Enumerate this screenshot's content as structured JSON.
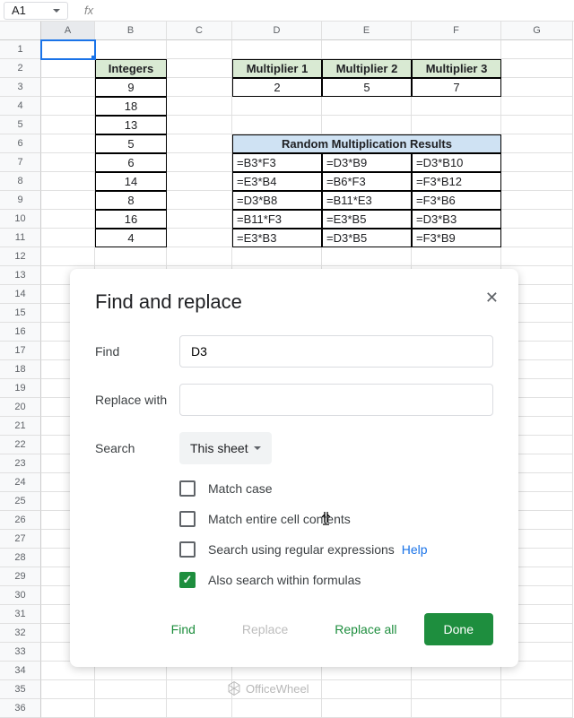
{
  "namebox": "A1",
  "fx_label": "fx",
  "col_headers": [
    "A",
    "B",
    "C",
    "D",
    "E",
    "F",
    "G"
  ],
  "row_count": 36,
  "integers": {
    "title": "Integers",
    "values": [
      9,
      18,
      13,
      5,
      6,
      14,
      8,
      16,
      4
    ]
  },
  "multipliers": {
    "headers": [
      "Multiplier 1",
      "Multiplier 2",
      "Multiplier 3"
    ],
    "values": [
      2,
      5,
      7
    ]
  },
  "results": {
    "title": "Random Multiplication Results",
    "rows": [
      [
        "=B3*F3",
        "=D3*B9",
        "=D3*B10"
      ],
      [
        "=E3*B4",
        "=B6*F3",
        "=F3*B12"
      ],
      [
        "=D3*B8",
        "=B11*E3",
        "=F3*B6"
      ],
      [
        "=B11*F3",
        "=E3*B5",
        "=D3*B3"
      ],
      [
        "=E3*B3",
        "=D3*B5",
        "=F3*B9"
      ]
    ]
  },
  "dialog": {
    "title": "Find and replace",
    "find_label": "Find",
    "find_value": "D3",
    "replace_label": "Replace with",
    "replace_value": "",
    "search_label": "Search",
    "search_scope": "This sheet",
    "match_case": "Match case",
    "match_entire": "Match entire cell contents",
    "regex": "Search using regular expressions",
    "help": "Help",
    "formulas": "Also search within formulas",
    "btn_find": "Find",
    "btn_replace": "Replace",
    "btn_replace_all": "Replace all",
    "btn_done": "Done"
  },
  "watermark": "OfficeWheel"
}
